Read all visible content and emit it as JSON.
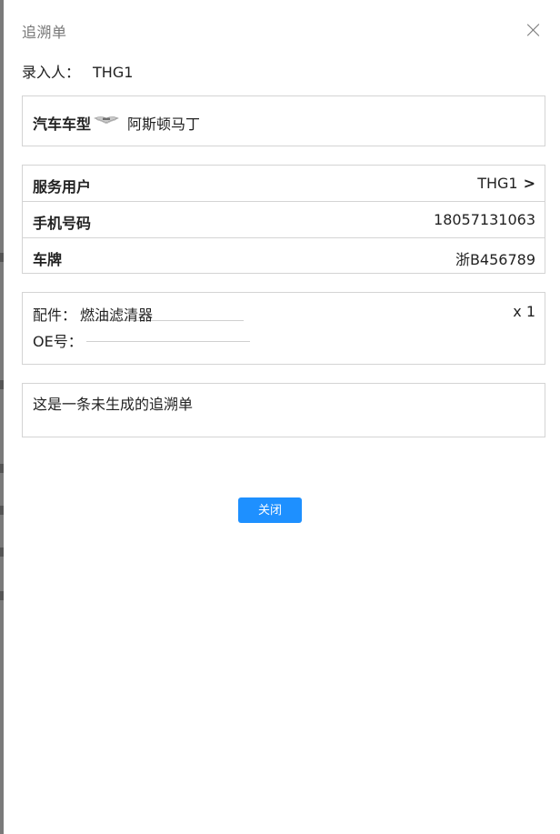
{
  "dialog": {
    "title": "追溯单",
    "entry_label": "录入人：",
    "entry_value": "THG1"
  },
  "car": {
    "label": "汽车车型",
    "logo_icon": "aston-martin-wings-logo",
    "value": "阿斯顿马丁"
  },
  "user_info": {
    "rows": [
      {
        "label": "服务用户",
        "value": "THG1",
        "chevron": ">"
      },
      {
        "label": "手机号码",
        "value": "18057131063"
      },
      {
        "label": "车牌",
        "value": "浙B456789"
      }
    ]
  },
  "parts": {
    "part_label": "配件：",
    "part_value": "燃油滤清器",
    "qty": "x 1",
    "oe_label": "OE号：",
    "oe_value": ""
  },
  "note": {
    "text": "这是一条未生成的追溯单"
  },
  "actions": {
    "close_label": "关闭"
  },
  "colors": {
    "accent": "#1e90ff",
    "border": "#d4d4d4",
    "title": "#777777"
  }
}
